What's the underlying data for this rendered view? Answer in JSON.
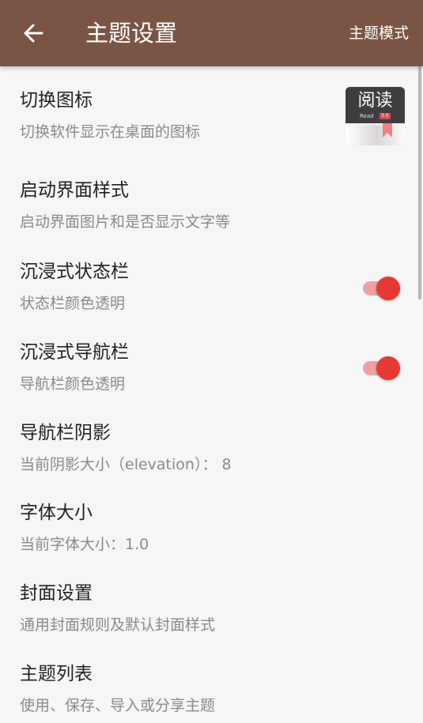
{
  "toolbar": {
    "back_icon": "arrow-left-icon",
    "title": "主题设置",
    "action": "主题模式",
    "background": "#7a5545"
  },
  "accent": "#e53935",
  "app_icon": {
    "text": "阅读",
    "subtext": "Read",
    "version": "3.0"
  },
  "preferences": [
    {
      "title": "切换图标",
      "summary": "切换软件显示在桌面的图标"
    },
    {
      "title": "启动界面样式",
      "summary": "启动界面图片和是否显示文字等"
    },
    {
      "title": "沉浸式状态栏",
      "summary": "状态栏颜色透明",
      "switch_on": true
    },
    {
      "title": "沉浸式导航栏",
      "summary": "导航栏颜色透明",
      "switch_on": true
    },
    {
      "title": "导航栏阴影",
      "summary": "当前阴影大小（elevation）： 8"
    },
    {
      "title": "字体大小",
      "summary": "当前字体大小：1.0"
    },
    {
      "title": "封面设置",
      "summary": "通用封面规则及默认封面样式"
    },
    {
      "title": "主题列表",
      "summary": "使用、保存、导入或分享主题"
    }
  ]
}
